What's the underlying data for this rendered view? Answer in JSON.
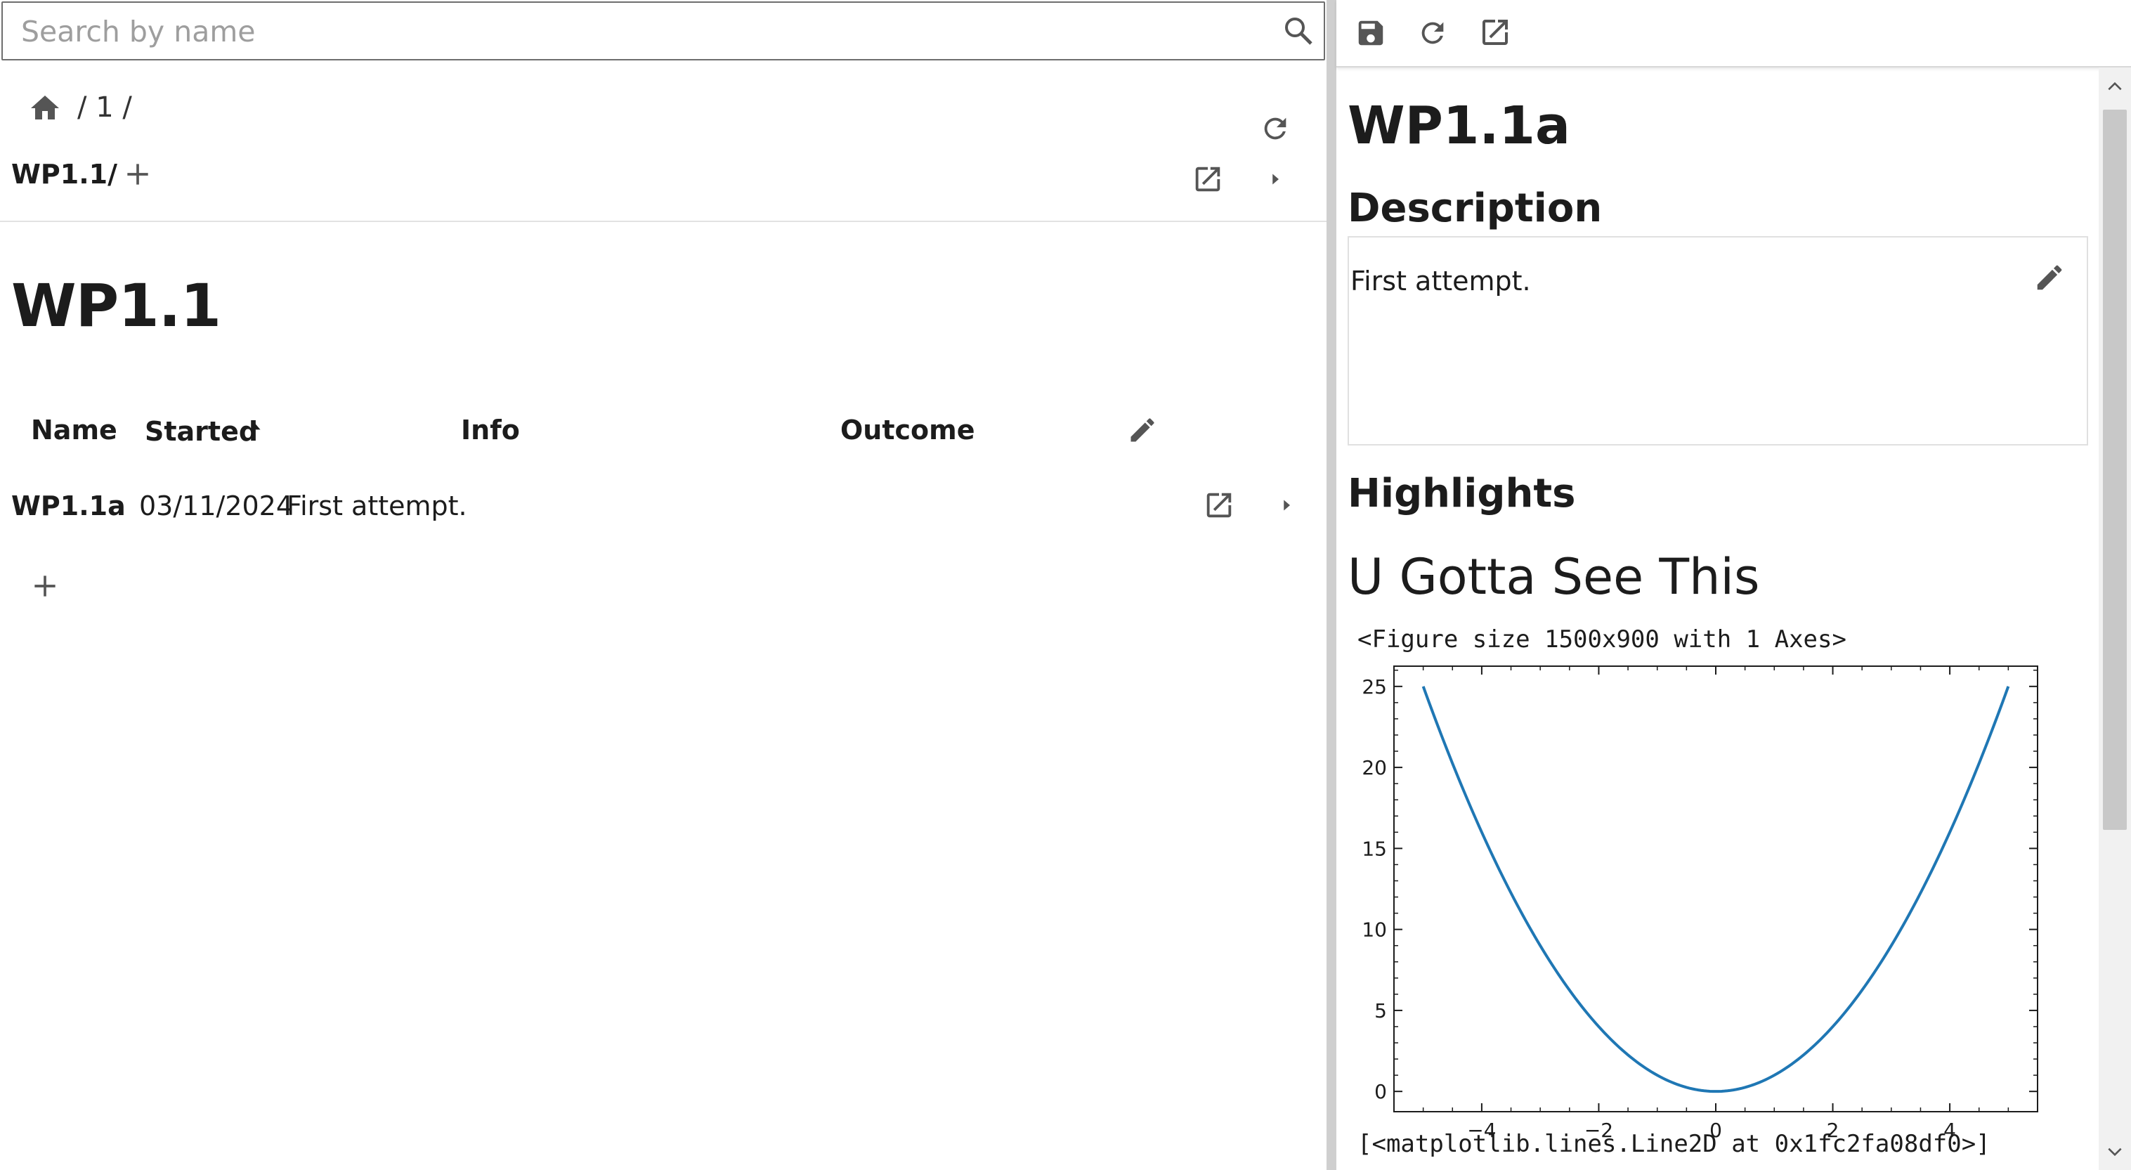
{
  "search": {
    "placeholder": "Search by name"
  },
  "left": {
    "breadcrumb_path": "/ 1 /",
    "current_path": "WP1.1/",
    "page_title": "WP1.1",
    "table": {
      "columns": [
        "Name",
        "Started",
        "Info",
        "Outcome"
      ],
      "sort_column": "Started",
      "sort_direction": "ascending",
      "rows": [
        {
          "name": "WP1.1a",
          "started": "03/11/2024",
          "info": "First attempt.",
          "outcome": ""
        }
      ]
    }
  },
  "right": {
    "title": "WP1.1a",
    "description_heading": "Description",
    "description_text": "First attempt.",
    "highlights_heading": "Highlights",
    "highlight": {
      "title": "U Gotta See This",
      "figure_repr": "<Figure size 1500x900 with 1 Axes>",
      "output_repr": "[<matplotlib.lines.Line2D at 0x1fc2fa08df0>]"
    }
  },
  "icons": [
    "search-icon",
    "home-icon",
    "refresh-icon",
    "add-icon",
    "open-external-icon",
    "chevron-right-icon",
    "edit-icon",
    "save-icon",
    "sort-ascending-icon",
    "scroll-up-icon",
    "scroll-down-icon"
  ],
  "colors": {
    "line": "#1f77b4",
    "text": "#1c1c1c",
    "icon": "#555555"
  },
  "chart_data": {
    "type": "line",
    "title": "",
    "xlabel": "",
    "ylabel": "",
    "xlim": [
      -5.5,
      5.5
    ],
    "ylim": [
      -1.25,
      26.25
    ],
    "xticks": [
      -4,
      -2,
      0,
      2,
      4
    ],
    "xtick_labels": [
      "−4",
      "−2",
      "0",
      "2",
      "4"
    ],
    "yticks": [
      0,
      5,
      10,
      15,
      20,
      25
    ],
    "ytick_labels": [
      "0",
      "5",
      "10",
      "15",
      "20",
      "25"
    ],
    "grid": false,
    "series": [
      {
        "x": [
          -5,
          -4.5,
          -4,
          -3.5,
          -3,
          -2.5,
          -2,
          -1.5,
          -1,
          -0.5,
          0,
          0.5,
          1,
          1.5,
          2,
          2.5,
          3,
          3.5,
          4,
          4.5,
          5
        ],
        "y": [
          25,
          20.25,
          16,
          12.25,
          9,
          6.25,
          4,
          2.25,
          1,
          0.25,
          0,
          0.25,
          1,
          2.25,
          4,
          6.25,
          9,
          12.25,
          16,
          20.25,
          25
        ]
      }
    ]
  }
}
